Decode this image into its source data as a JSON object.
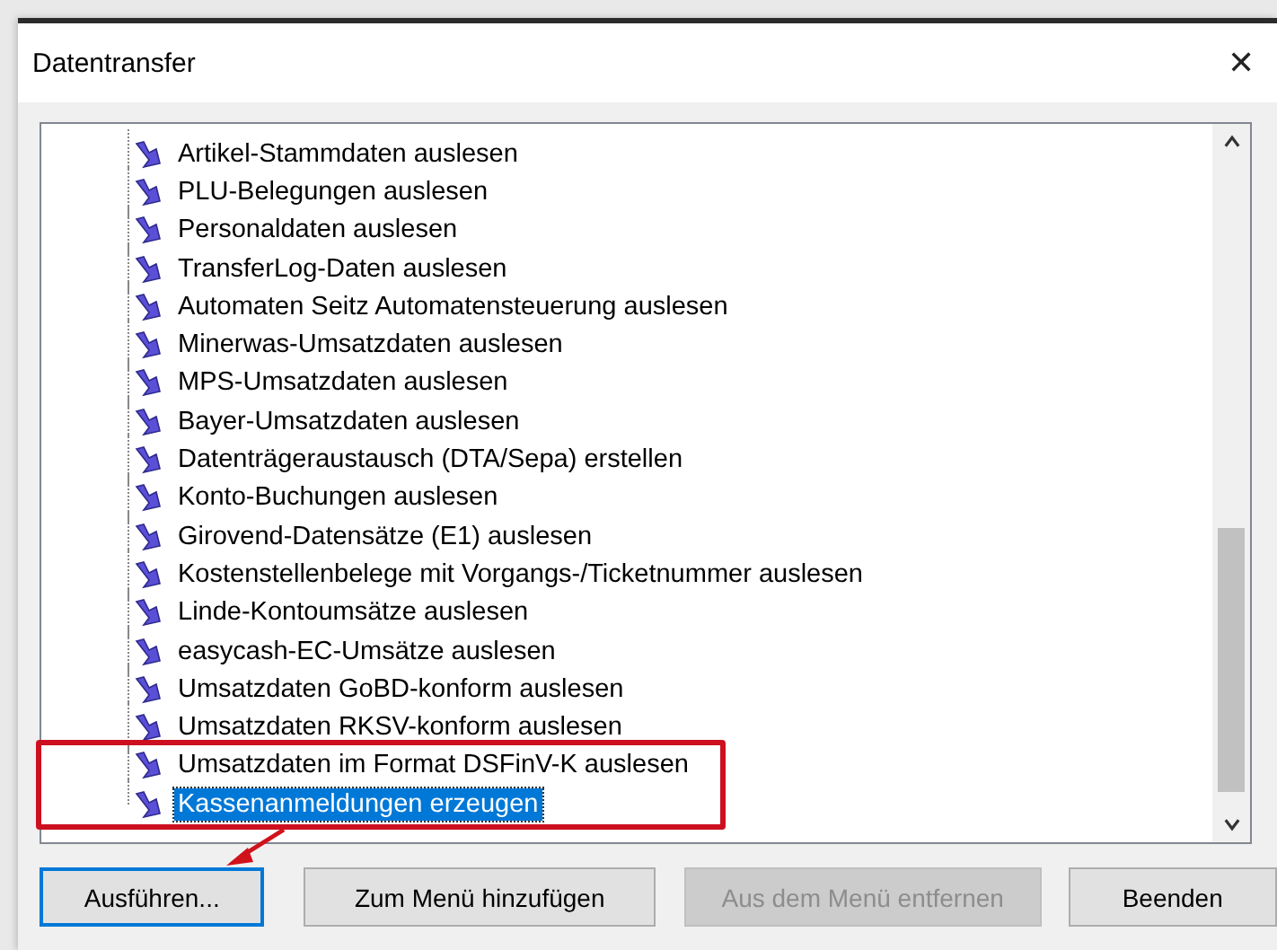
{
  "window": {
    "title": "Datentransfer",
    "close": "✕"
  },
  "list": {
    "items": [
      {
        "label": "Artikel-Stammdaten auslesen",
        "selected": false
      },
      {
        "label": "PLU-Belegungen auslesen",
        "selected": false
      },
      {
        "label": "Personaldaten auslesen",
        "selected": false
      },
      {
        "label": "TransferLog-Daten auslesen",
        "selected": false
      },
      {
        "label": "Automaten Seitz Automatensteuerung auslesen",
        "selected": false
      },
      {
        "label": "Minerwas-Umsatzdaten auslesen",
        "selected": false
      },
      {
        "label": "MPS-Umsatzdaten auslesen",
        "selected": false
      },
      {
        "label": "Bayer-Umsatzdaten auslesen",
        "selected": false
      },
      {
        "label": "Datenträgeraustausch (DTA/Sepa) erstellen",
        "selected": false
      },
      {
        "label": "Konto-Buchungen auslesen",
        "selected": false
      },
      {
        "label": "Girovend-Datensätze (E1) auslesen",
        "selected": false
      },
      {
        "label": "Kostenstellenbelege mit Vorgangs-/Ticketnummer auslesen",
        "selected": false
      },
      {
        "label": "Linde-Kontoumsätze auslesen",
        "selected": false
      },
      {
        "label": "easycash-EC-Umsätze auslesen",
        "selected": false
      },
      {
        "label": "Umsatzdaten GoBD-konform auslesen",
        "selected": false
      },
      {
        "label": "Umsatzdaten RKSV-konform auslesen",
        "selected": false
      },
      {
        "label": "Umsatzdaten im Format DSFinV-K auslesen",
        "selected": false
      },
      {
        "label": "Kassenanmeldungen erzeugen",
        "selected": true
      }
    ]
  },
  "buttons": [
    {
      "label": "Ausführen...",
      "default": true,
      "disabled": false
    },
    {
      "label": "Zum Menü hinzufügen",
      "default": false,
      "disabled": false
    },
    {
      "label": "Aus dem Menü entfernen",
      "default": false,
      "disabled": true
    },
    {
      "label": "Beenden",
      "default": false,
      "disabled": false
    }
  ]
}
